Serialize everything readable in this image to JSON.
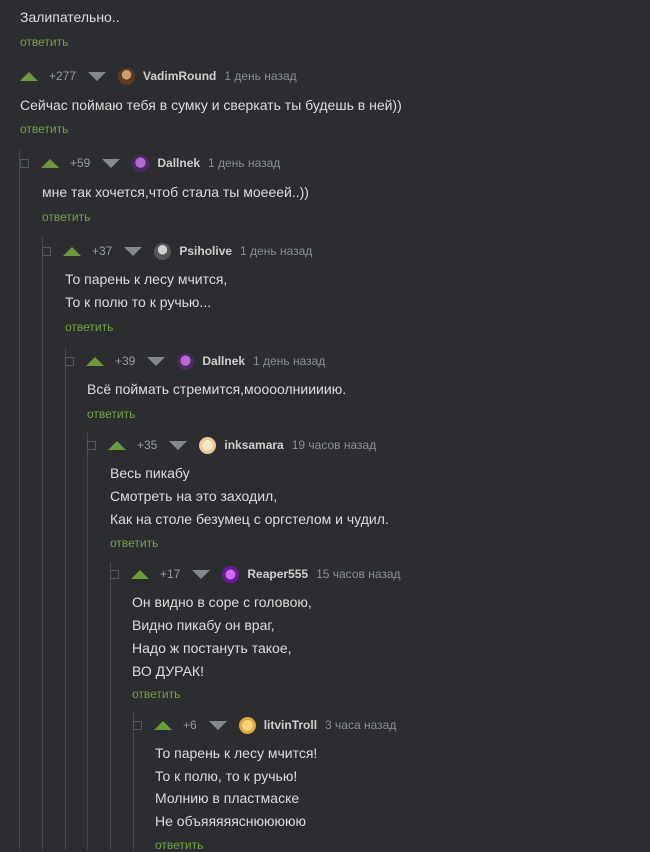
{
  "reply_label": "ответить",
  "top": {
    "text": "Залипательно.."
  },
  "comments": [
    {
      "rating": "+277",
      "author": "VadimRound",
      "time": "1 день назад",
      "lines": [
        "Сейчас поймаю тебя в сумку и сверкать ты будешь в ней))"
      ]
    },
    {
      "rating": "+59",
      "author": "Dallnek",
      "time": "1 день назад",
      "lines": [
        "мне так хочется,чтоб стала ты моееей..))"
      ]
    },
    {
      "rating": "+37",
      "author": "Psiholive",
      "time": "1 день назад",
      "lines": [
        "То парень к лесу мчится,",
        "То к полю то к ручью..."
      ]
    },
    {
      "rating": "+39",
      "author": "Dallnek",
      "time": "1 день назад",
      "lines": [
        "Всё поймать стремится,моооолниииию."
      ]
    },
    {
      "rating": "+35",
      "author": "inksamara",
      "time": "19 часов назад",
      "lines": [
        "Весь пикабу",
        "Смотреть на это заходил,",
        "Как на столе безумец с оргстелом и чудил."
      ]
    },
    {
      "rating": "+17",
      "author": "Reaper555",
      "time": "15 часов назад",
      "lines": [
        "Он видно в соре с головою,",
        "Видно пикабу он враг,",
        "Надо ж постануть такое,",
        "ВО ДУРАК!"
      ]
    },
    {
      "rating": "+6",
      "author": "litvinTroll",
      "time": "3 часа назад",
      "lines": [
        "То парень к лесу мчится!",
        "То к полю, то к ручью!",
        "Молнию в пластмаске",
        "Не объяяяяяснююююю"
      ]
    }
  ],
  "colors": {
    "background": "#2b2d30",
    "upvote": "#6b9a3e",
    "reply": "#75a446",
    "downvote": "#85888c"
  }
}
